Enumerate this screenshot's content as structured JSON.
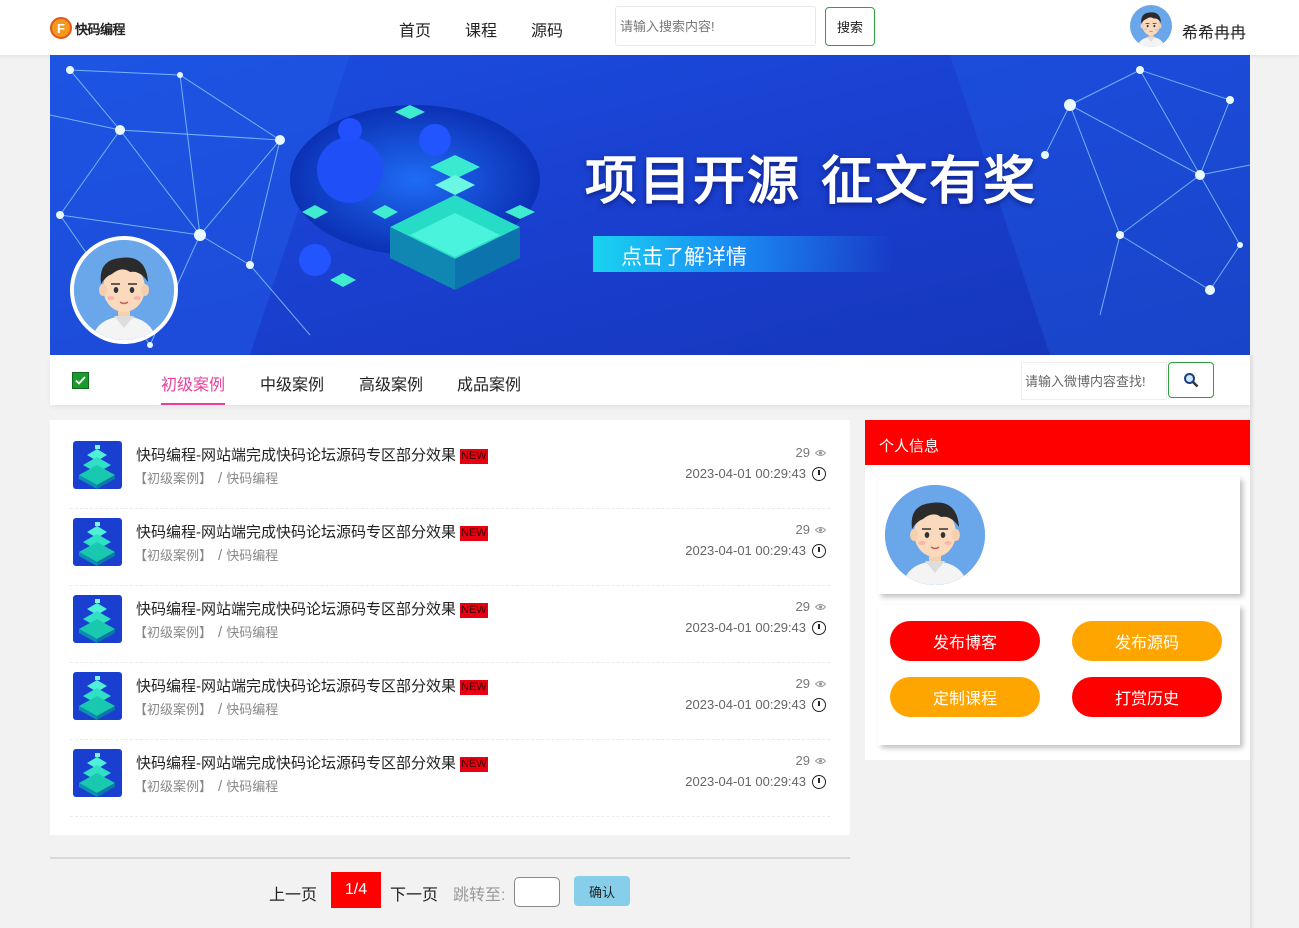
{
  "header": {
    "logo_text": "快码编程",
    "logo_letter": "F",
    "nav": [
      "首页",
      "课程",
      "源码"
    ],
    "search_placeholder": "请输入搜索内容!",
    "search_button": "搜索",
    "username": "希希冉冉"
  },
  "banner": {
    "title": "项目开源 征文有奖",
    "cta": "点击了解详情"
  },
  "tabs": {
    "items": [
      "初级案例",
      "中级案例",
      "高级案例",
      "成品案例"
    ],
    "active_index": 0,
    "search_placeholder": "请输入微博内容查找!"
  },
  "list": {
    "items": [
      {
        "title": "快码编程-网站端完成快码论坛源码专区部分效果",
        "badge": "NEW",
        "category": "【初级案例】",
        "author": "快码编程",
        "views": "29",
        "date": "2023-04-01 00:29:43"
      },
      {
        "title": "快码编程-网站端完成快码论坛源码专区部分效果",
        "badge": "NEW",
        "category": "【初级案例】",
        "author": "快码编程",
        "views": "29",
        "date": "2023-04-01 00:29:43"
      },
      {
        "title": "快码编程-网站端完成快码论坛源码专区部分效果",
        "badge": "NEW",
        "category": "【初级案例】",
        "author": "快码编程",
        "views": "29",
        "date": "2023-04-01 00:29:43"
      },
      {
        "title": "快码编程-网站端完成快码论坛源码专区部分效果",
        "badge": "NEW",
        "category": "【初级案例】",
        "author": "快码编程",
        "views": "29",
        "date": "2023-04-01 00:29:43"
      },
      {
        "title": "快码编程-网站端完成快码论坛源码专区部分效果",
        "badge": "NEW",
        "category": "【初级案例】",
        "author": "快码编程",
        "views": "29",
        "date": "2023-04-01 00:29:43"
      }
    ],
    "separator": "/"
  },
  "sidebar": {
    "header": "个人信息",
    "buttons": [
      {
        "label": "发布博客",
        "color": "#ff0000"
      },
      {
        "label": "发布源码",
        "color": "#ffa500"
      },
      {
        "label": "定制课程",
        "color": "#ffa500"
      },
      {
        "label": "打赏历史",
        "color": "#ff0000"
      }
    ]
  },
  "pagination": {
    "prev": "上一页",
    "current": "1/4",
    "next": "下一页",
    "jump_label": "跳转至:",
    "confirm": "确认"
  },
  "colors": {
    "accent_red": "#ff0000",
    "accent_orange": "#ffa500",
    "tab_active": "#e8409a",
    "button_border": "#2ea043"
  }
}
